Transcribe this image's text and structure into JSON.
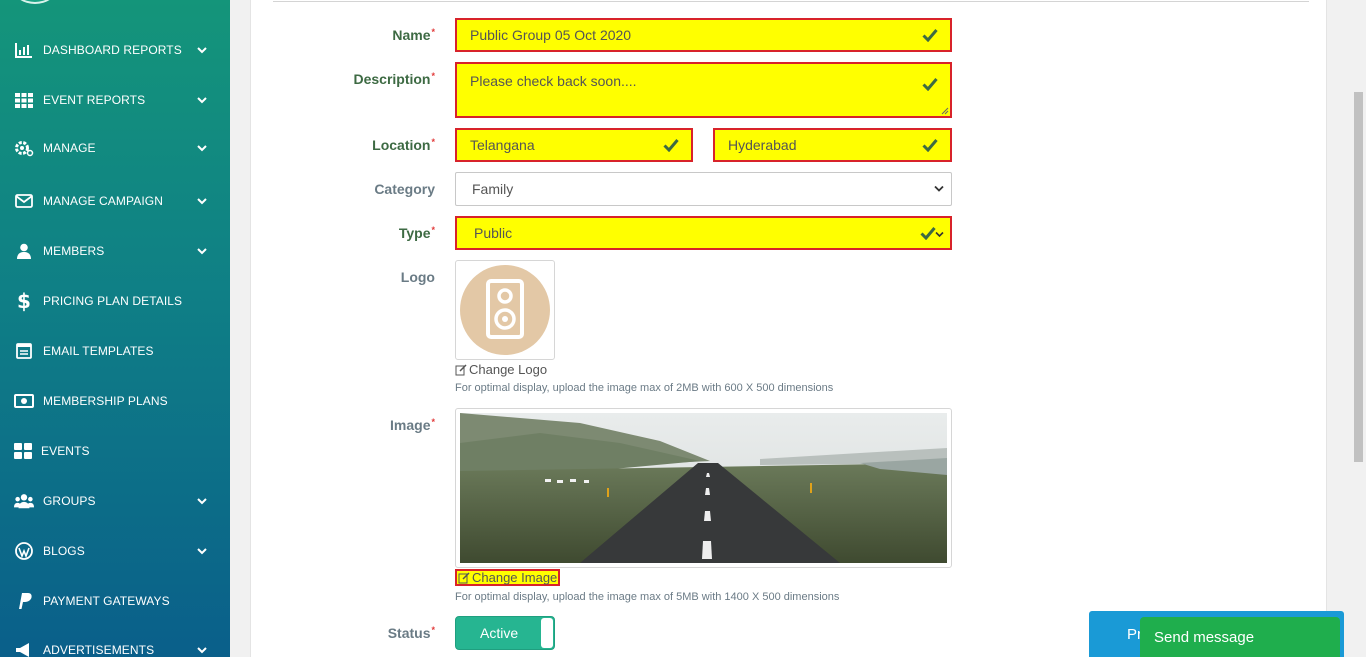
{
  "sidebar": {
    "items": [
      {
        "label": "DASHBOARD REPORTS",
        "icon": "bar-chart-icon",
        "chevron": true
      },
      {
        "label": "EVENT REPORTS",
        "icon": "grid-icon",
        "chevron": true
      },
      {
        "label": "MANAGE",
        "icon": "gear-icon",
        "chevron": true
      },
      {
        "label": "MANAGE CAMPAIGN",
        "icon": "envelope-icon",
        "chevron": true
      },
      {
        "label": "MEMBERS",
        "icon": "user-icon",
        "chevron": true
      },
      {
        "label": "PRICING PLAN DETAILS",
        "icon": "dollar-icon",
        "chevron": false
      },
      {
        "label": "EMAIL TEMPLATES",
        "icon": "template-icon",
        "chevron": false
      },
      {
        "label": "MEMBERSHIP PLANS",
        "icon": "money-icon",
        "chevron": false
      },
      {
        "label": "EVENTS",
        "icon": "tiles-icon",
        "chevron": false
      },
      {
        "label": "GROUPS",
        "icon": "users-icon",
        "chevron": true
      },
      {
        "label": "BLOGS",
        "icon": "wordpress-icon",
        "chevron": true
      },
      {
        "label": "PAYMENT GATEWAYS",
        "icon": "paypal-icon",
        "chevron": false
      },
      {
        "label": "ADVERTISEMENTS",
        "icon": "megaphone-icon",
        "chevron": true
      }
    ]
  },
  "form": {
    "name": {
      "label": "Name",
      "value": "Public Group 05 Oct 2020"
    },
    "description": {
      "label": "Description",
      "value": "Please check back soon...."
    },
    "location": {
      "label": "Location",
      "state": "Telangana",
      "city": "Hyderabad"
    },
    "category": {
      "label": "Category",
      "value": "Family"
    },
    "type": {
      "label": "Type",
      "value": "Public"
    },
    "logo": {
      "label": "Logo",
      "change": "Change Logo",
      "hint": "For optimal display, upload the image max of 2MB with 600 X 500 dimensions"
    },
    "image": {
      "label": "Image",
      "change": "Change Image",
      "hint": "For optimal display, upload the image max of 5MB with 1400 X 500 dimensions"
    },
    "status": {
      "label": "Status",
      "value": "Active"
    },
    "required_mark": "*"
  },
  "footer": {
    "submit_partial": "Pr",
    "chat_label": "Send message"
  },
  "colors": {
    "sidebar_top": "#14957a",
    "sidebar_bottom": "#0a5f8a",
    "field_highlight": "#ffff00",
    "field_border": "#d8232a",
    "check": "#3d6a43",
    "status_toggle": "#26b591",
    "chat": "#1fae4d",
    "submit": "#1a9ad6"
  }
}
